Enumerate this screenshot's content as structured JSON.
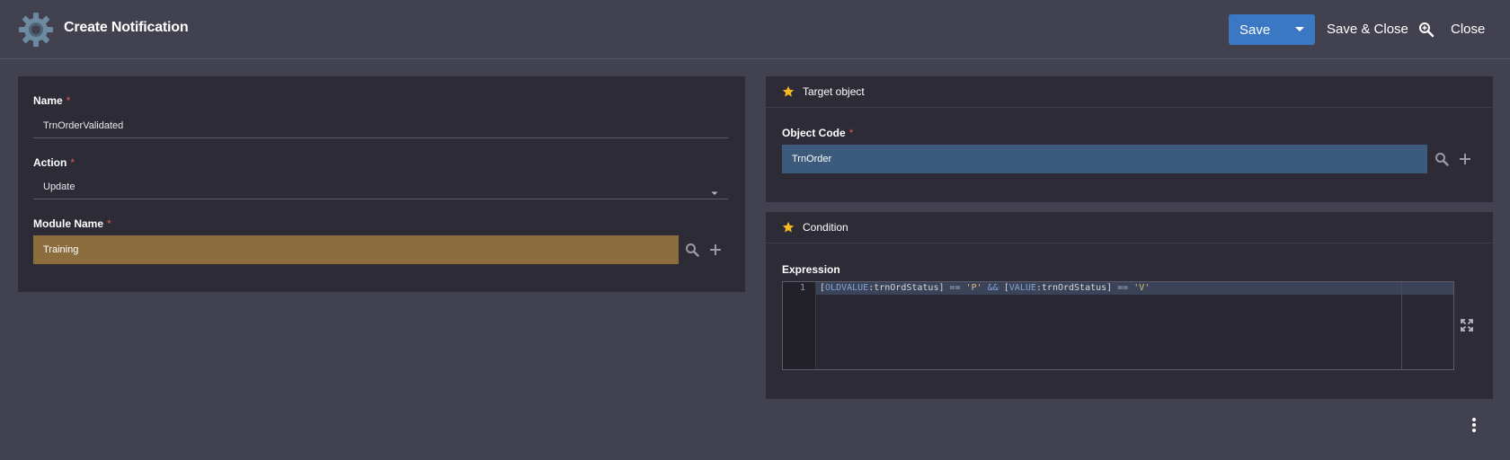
{
  "header": {
    "title": "Create Notification",
    "save_label": "Save",
    "save_close_label": "Save & Close",
    "close_label": "Close",
    "gear_icon": "gear-icon",
    "zoom_icon": "zoom-search-icon",
    "caret_icon": "caret-down-icon"
  },
  "form": {
    "name": {
      "label": "Name",
      "required": "*",
      "value": "TrnOrderValidated"
    },
    "action": {
      "label": "Action",
      "required": "*",
      "value": "Update"
    },
    "module": {
      "label": "Module Name",
      "required": "*",
      "value": "Training"
    }
  },
  "target": {
    "title": "Target object",
    "object_code": {
      "label": "Object Code",
      "required": "*",
      "value": "TrnOrder"
    }
  },
  "condition": {
    "title": "Condition",
    "expression_label": "Expression",
    "line_number": "1",
    "code": {
      "t1": "[",
      "t2": "OLDVALUE",
      "t3": ":trnOrdStatus] ",
      "t4": "==",
      "t5": " ",
      "t6": "'P'",
      "t7": " ",
      "t8": "&&",
      "t9": " [",
      "t10": "VALUE",
      "t11": ":trnOrdStatus] ",
      "t12": "==",
      "t13": " ",
      "t14": "'V'"
    }
  },
  "colors": {
    "background": "#42414f",
    "panel": "#2c2b36",
    "save_blue": "#3b78c4",
    "module_field": "#8c6d3d",
    "object_field": "#3c5a7b",
    "required": "#e05a5a",
    "star": "#f5b921"
  }
}
